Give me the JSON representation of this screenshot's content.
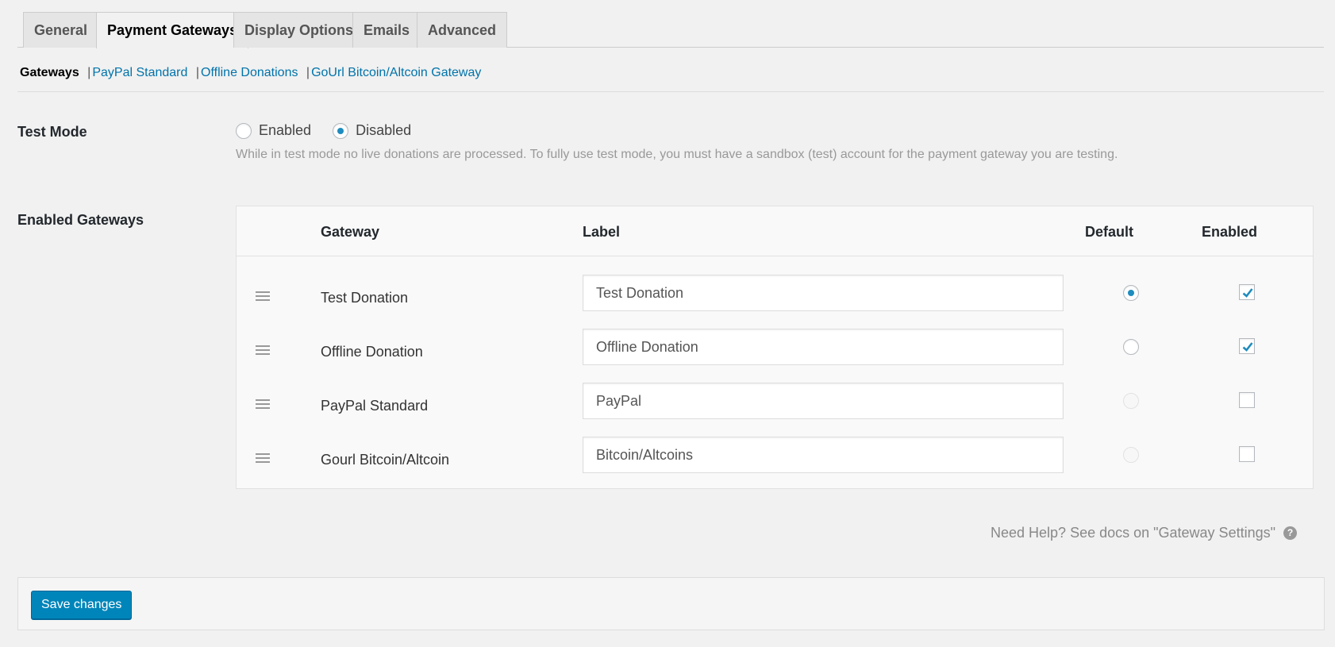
{
  "tabs": [
    {
      "label": "General"
    },
    {
      "label": "Payment Gateways"
    },
    {
      "label": "Display Options"
    },
    {
      "label": "Emails"
    },
    {
      "label": "Advanced"
    }
  ],
  "subnav": {
    "current": "Gateways",
    "separator": "|",
    "links": [
      "PayPal Standard",
      "Offline Donations",
      "GoUrl Bitcoin/Altcoin Gateway"
    ]
  },
  "test_mode": {
    "label": "Test Mode",
    "options": [
      "Enabled",
      "Disabled"
    ],
    "selected": "Disabled",
    "description": "While in test mode no live donations are processed. To fully use test mode, you must have a sandbox (test) account for the payment gateway you are testing."
  },
  "enabled_gateways": {
    "label": "Enabled Gateways",
    "columns": {
      "gateway": "Gateway",
      "label": "Label",
      "default": "Default",
      "enabled": "Enabled"
    },
    "rows": [
      {
        "gateway": "Test Donation",
        "label": "Test Donation",
        "default": true,
        "enabled": true,
        "default_disabled": false
      },
      {
        "gateway": "Offline Donation",
        "label": "Offline Donation",
        "default": false,
        "enabled": true,
        "default_disabled": false
      },
      {
        "gateway": "PayPal Standard",
        "label": "PayPal",
        "default": false,
        "enabled": false,
        "default_disabled": true
      },
      {
        "gateway": "Gourl Bitcoin/Altcoin",
        "label": "Bitcoin/Altcoins",
        "default": false,
        "enabled": false,
        "default_disabled": true
      }
    ]
  },
  "help": {
    "text": "Need Help? See docs on \"Gateway Settings\"",
    "icon": "?"
  },
  "footer": {
    "save_label": "Save changes"
  },
  "colors": {
    "accent": "#0085ba",
    "link": "#0073aa",
    "radio_dot": "#1e8cbe"
  }
}
